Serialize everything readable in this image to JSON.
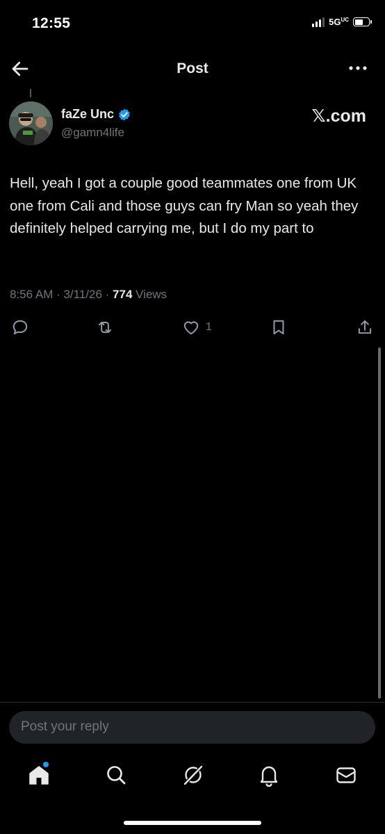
{
  "status": {
    "time": "12:55",
    "network": "5G",
    "network_sub": "UC"
  },
  "header": {
    "title": "Post"
  },
  "post": {
    "author_name": "faZe Unc",
    "handle": "@gamn4life",
    "source_badge": "𝕏.com",
    "text": "Hell, yeah I got a couple good teammates one from UK one from Cali and those guys can fry Man so yeah they definitely helped carrying me, but I do my part to",
    "meta_time": "8:56 AM · 3/11/26 · ",
    "views_count": "774",
    "views_label": " Views",
    "like_count": "1"
  },
  "reply": {
    "placeholder": "Post your reply"
  },
  "icons": {
    "back": "arrow-left-icon",
    "more": "more-horizontal-icon",
    "verified": "verified-badge-icon",
    "reply": "reply-icon",
    "repost": "repost-icon",
    "like": "heart-icon",
    "bookmark": "bookmark-icon",
    "share": "share-icon",
    "home": "home-icon",
    "search": "search-icon",
    "grok": "grok-icon",
    "notifications": "bell-icon",
    "messages": "mail-icon"
  },
  "colors": {
    "accent": "#1d9bf0",
    "background": "#000000",
    "muted": "#71767b",
    "text": "#e7e9ea"
  }
}
